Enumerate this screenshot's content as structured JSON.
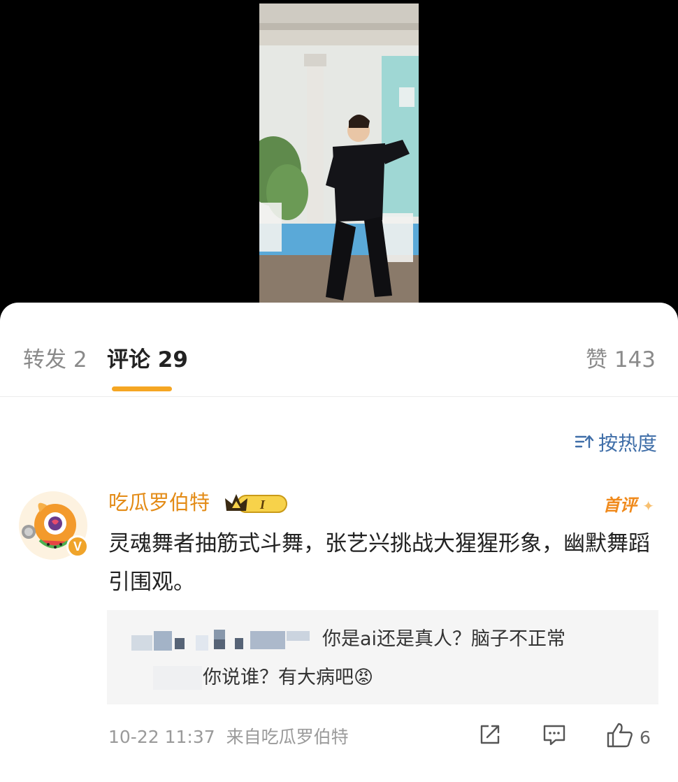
{
  "tabs": {
    "repost": "转发 2",
    "comments": "评论 29",
    "likes": "赞 143"
  },
  "sort": {
    "label": "按热度",
    "icon": "sort-icon"
  },
  "comment": {
    "username": "吃瓜罗伯特",
    "level_badge": "I",
    "first_label": "首评",
    "text": "灵魂舞者抽筋式斗舞，张艺兴挑战大猩猩形象，幽默舞蹈引围观。",
    "verified": "V",
    "reply": {
      "line1": "你是ai还是真人？脑子不正常",
      "line2": "你说谁？有大病吧😡"
    },
    "timestamp": "10-22 11:37",
    "source": "来自吃瓜罗伯特",
    "like_count": "6"
  },
  "colors": {
    "accent": "#f5a623",
    "username": "#e38b16",
    "link": "#3f6ea8"
  }
}
